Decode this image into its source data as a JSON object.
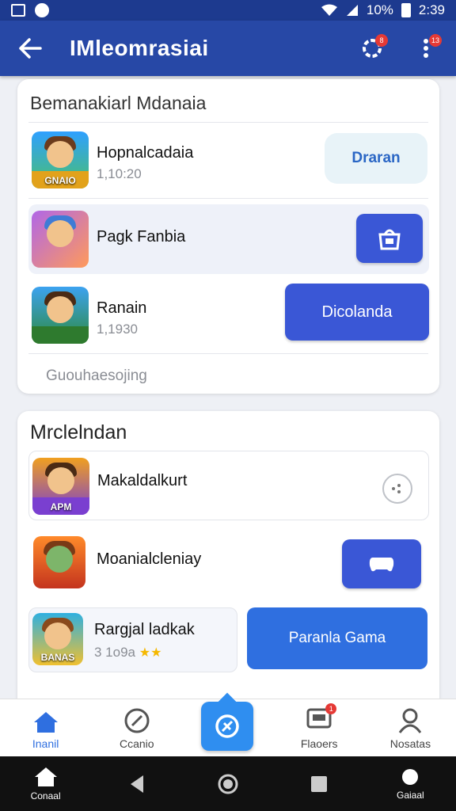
{
  "status_bar": {
    "right_text": "10%",
    "time": "2:39"
  },
  "app_bar": {
    "title": "IMleomrasiai",
    "badge1": "8",
    "badge2": "13"
  },
  "section1": {
    "title": "Bemanakiarl Mdanaia",
    "items": [
      {
        "name": "Hopnalcadaia",
        "sub": "1,10:20",
        "button": "Draran",
        "thumb_text": "GNAIO"
      },
      {
        "name": "Pagk Fanbia",
        "sub": "",
        "button": ""
      },
      {
        "name": "Ranain",
        "sub": "1,1930",
        "button": "Dicolanda"
      }
    ],
    "footer_link": "Guouhaesojing"
  },
  "section2": {
    "title": "Mrclelndan",
    "items": [
      {
        "name": "Makaldalkurt",
        "sub": "",
        "thumb_text": "APM"
      },
      {
        "name": "Moanialcleniay",
        "sub": ""
      },
      {
        "name": "Rargjal ladkak",
        "sub": "3 1o9a",
        "button": "Paranla Gama",
        "thumb_text": "BANAS"
      }
    ]
  },
  "bottom_nav": [
    {
      "label": "Inanil"
    },
    {
      "label": "Ccanio"
    },
    {
      "label": ""
    },
    {
      "label": "Flaoers",
      "badge": "1"
    },
    {
      "label": "Nosatas"
    }
  ],
  "system_bar": {
    "home_label": "Conaal",
    "right_label": "Gaiaal"
  },
  "colors": {
    "app_bar": "#2748a6",
    "accent": "#3a57d6",
    "bright": "#2f6fe0"
  }
}
